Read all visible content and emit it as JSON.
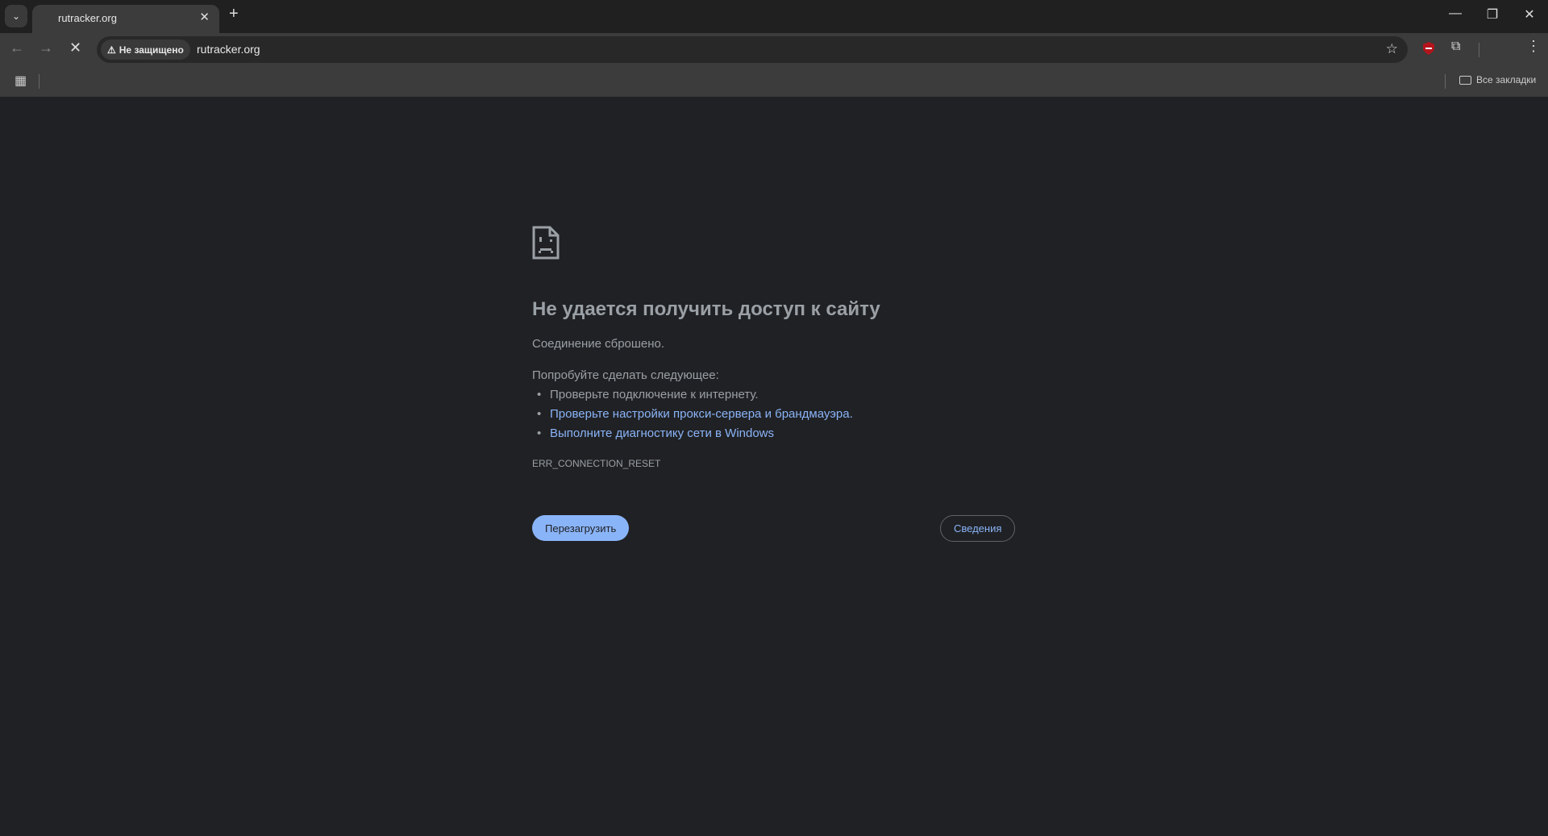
{
  "tab": {
    "title": "rutracker.org"
  },
  "omnibox": {
    "security_label": "Не защищено",
    "url": "rutracker.org"
  },
  "bookmarks": {
    "all_label": "Все закладки"
  },
  "error": {
    "title": "Не удается получить доступ к сайту",
    "subtitle": "Соединение сброшено.",
    "suggest_heading": "Попробуйте сделать следующее:",
    "suggestions": [
      "Проверьте подключение к интернету.",
      "Проверьте настройки прокси-сервера и брандмауэра.",
      "Выполните диагностику сети в Windows"
    ],
    "code": "ERR_CONNECTION_RESET",
    "reload_label": "Перезагрузить",
    "details_label": "Сведения"
  },
  "colors": {
    "accent": "#8ab4f8",
    "background": "#202124",
    "shield": "#b3141c"
  }
}
